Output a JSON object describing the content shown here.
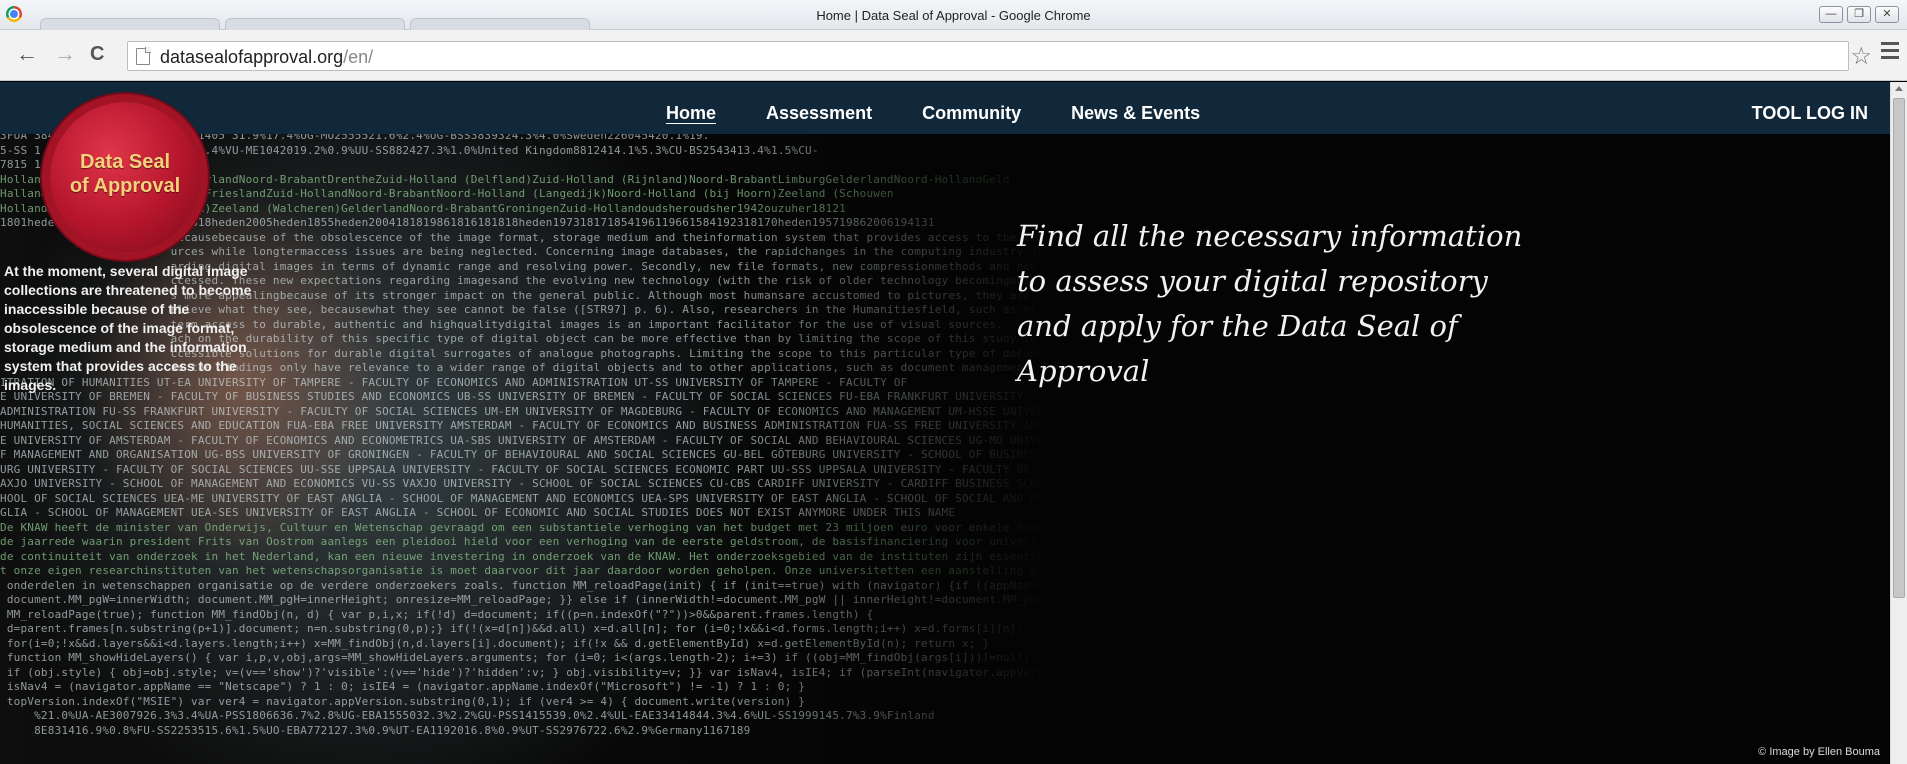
{
  "window": {
    "title": "Home | Data Seal of Approval - Google Chrome",
    "controls": [
      "—",
      "❐",
      "✕"
    ]
  },
  "toolbar": {
    "back": "←",
    "forward": "→",
    "reload": "C",
    "url_host": "datasealofapproval.org",
    "url_path": "/en/",
    "bookmark": "☆"
  },
  "site": {
    "logo": "Data Seal of Approval",
    "nav": [
      "Home",
      "Assessment",
      "Community",
      "News & Events"
    ],
    "tool_login": "TOOL LOG IN",
    "tagline": "Find all the necessary information to assess your digital repository and apply for the Data Seal of Approval",
    "credit": "© Image by Ellen Bouma",
    "hero_caption": "At the moment, several digital image collections are threatened to become inaccessible because of the obsolescence of the image format, storage medium and the information system that provides access to the images."
  },
  "colors": {
    "header_bg": "#11283a",
    "seal": "#b4152c",
    "seal_text": "#f4d27a",
    "page_bg": "#040404"
  }
}
